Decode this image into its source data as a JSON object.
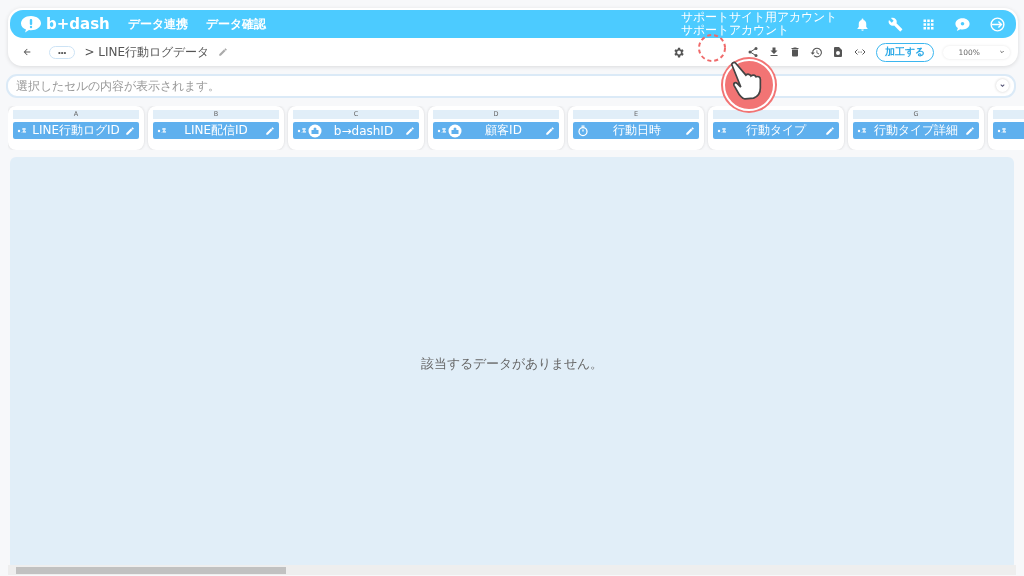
{
  "header": {
    "logo": "b+dash",
    "nav": [
      "データ連携",
      "データ確認"
    ],
    "account": {
      "site": "サポートサイト用アカウント",
      "user": "サポートアカウント"
    }
  },
  "toolbar": {
    "breadcrumb_more": "•••",
    "breadcrumb": "> LINE行動ログデータ",
    "process_button": "加工する",
    "zoom": "100%"
  },
  "cell_bar": {
    "placeholder": "選択したセルの内容が表示されます。"
  },
  "columns": [
    {
      "letter": "A",
      "name": "LINE行動ログID",
      "kind": "text"
    },
    {
      "letter": "B",
      "name": "LINE配信ID",
      "kind": "text"
    },
    {
      "letter": "C",
      "name": "b→dashID",
      "kind": "id"
    },
    {
      "letter": "D",
      "name": "顧客ID",
      "kind": "id"
    },
    {
      "letter": "E",
      "name": "行動日時",
      "kind": "datetime"
    },
    {
      "name": "行動タイプ",
      "kind": "text"
    },
    {
      "letter": "G",
      "name": "行動タイプ詳細",
      "kind": "text"
    },
    {
      "kind": "text"
    }
  ],
  "empty_message": "該当するデータがありません。"
}
